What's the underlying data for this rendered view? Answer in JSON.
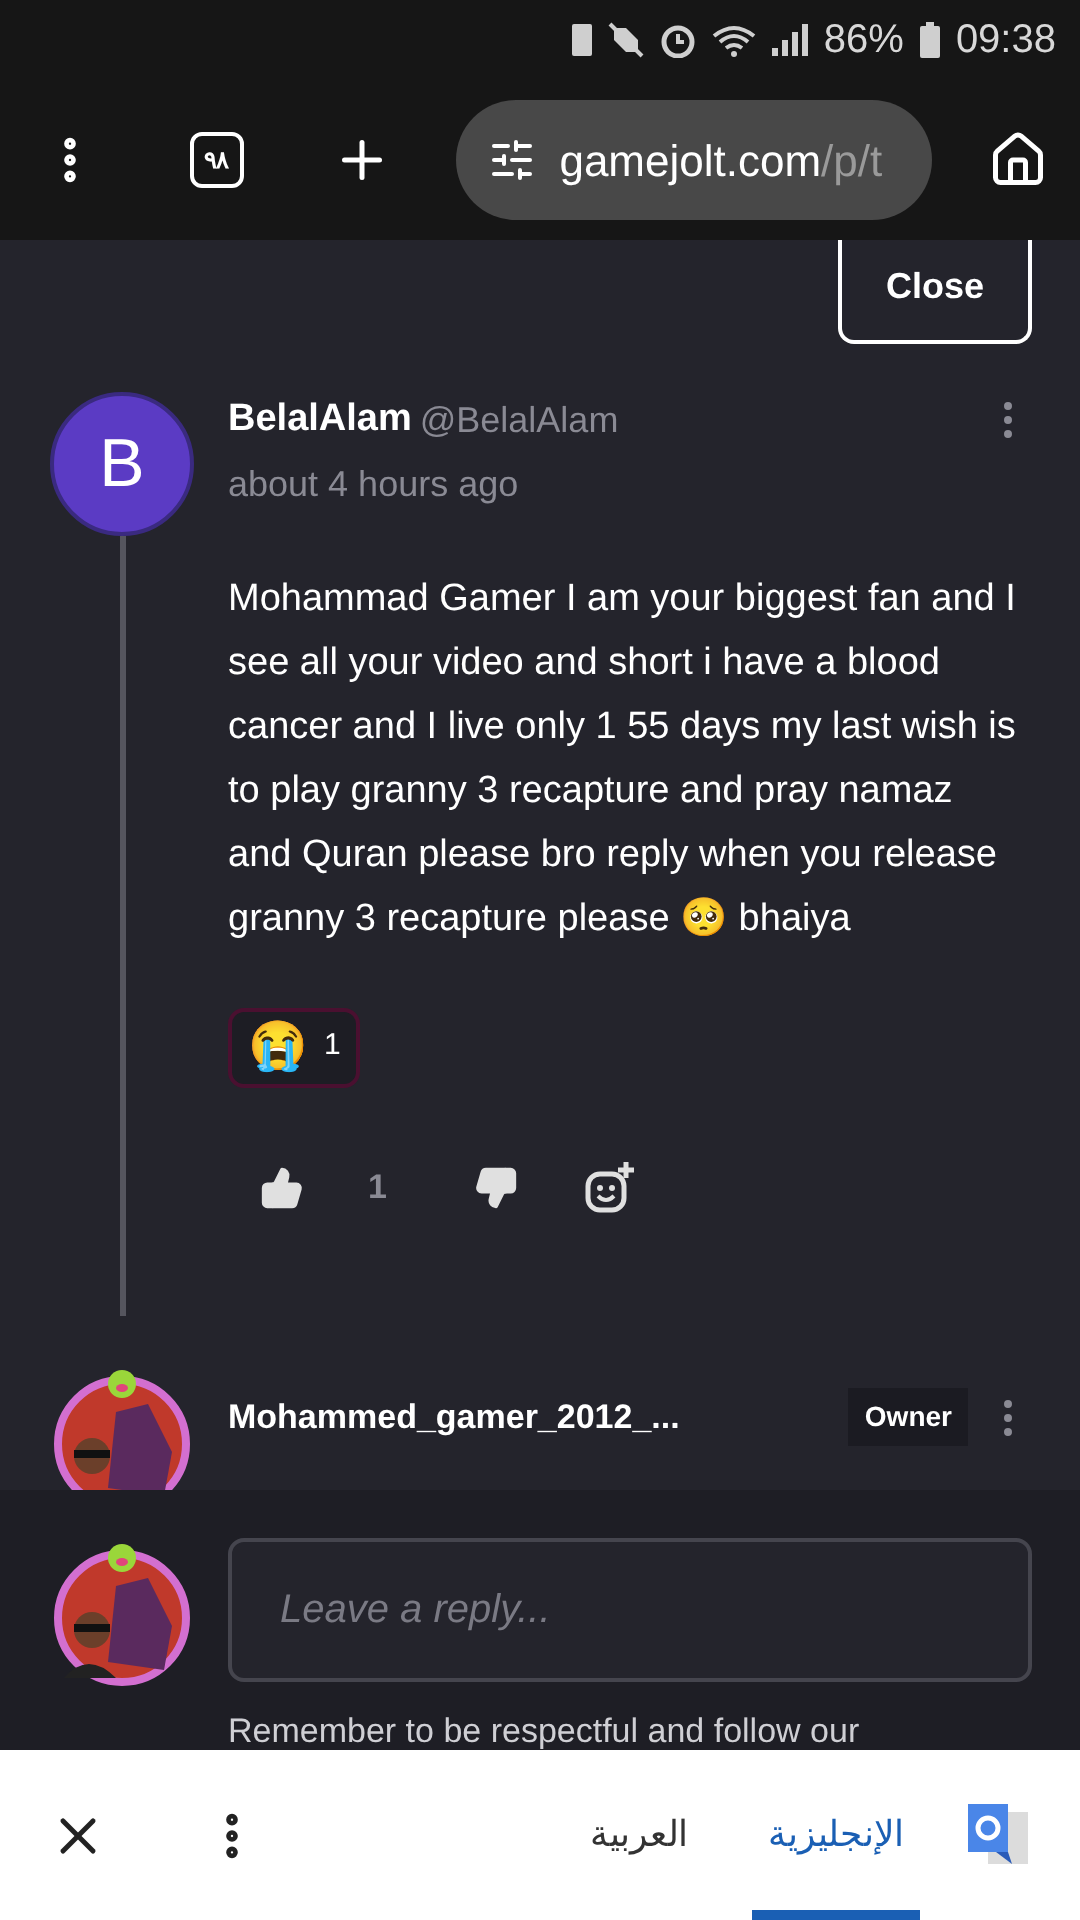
{
  "status_bar": {
    "battery": "86%",
    "time": "09:38"
  },
  "browser": {
    "tab_count": "٩٨",
    "url_host": "gamejolt.com",
    "url_path": "/p/t"
  },
  "close_button": "Close",
  "comment": {
    "avatar_letter": "B",
    "author": "BelalAlam",
    "handle": "@BelalAlam",
    "time": "about 4 hours ago",
    "body": "Mohammad Gamer I am your biggest fan and I see all your video and short i have a blood cancer and I live only 1 55 days my last wish is to play granny 3 recapture and pray namaz and Quran please bro reply when you release granny 3 recapture please 🥺 bhaiya",
    "reactions": [
      {
        "emoji": "😭",
        "count": "1"
      }
    ],
    "likes": "1"
  },
  "reply": {
    "author": "Mohammed_gamer_2012_...",
    "badge": "Owner"
  },
  "reply_box": {
    "placeholder": "Leave a reply...",
    "note": "Remember to be respectful and follow our"
  },
  "translate_bar": {
    "languages": [
      {
        "label": "الإنجليزية",
        "selected": true
      },
      {
        "label": "العربية",
        "selected": false
      }
    ]
  }
}
